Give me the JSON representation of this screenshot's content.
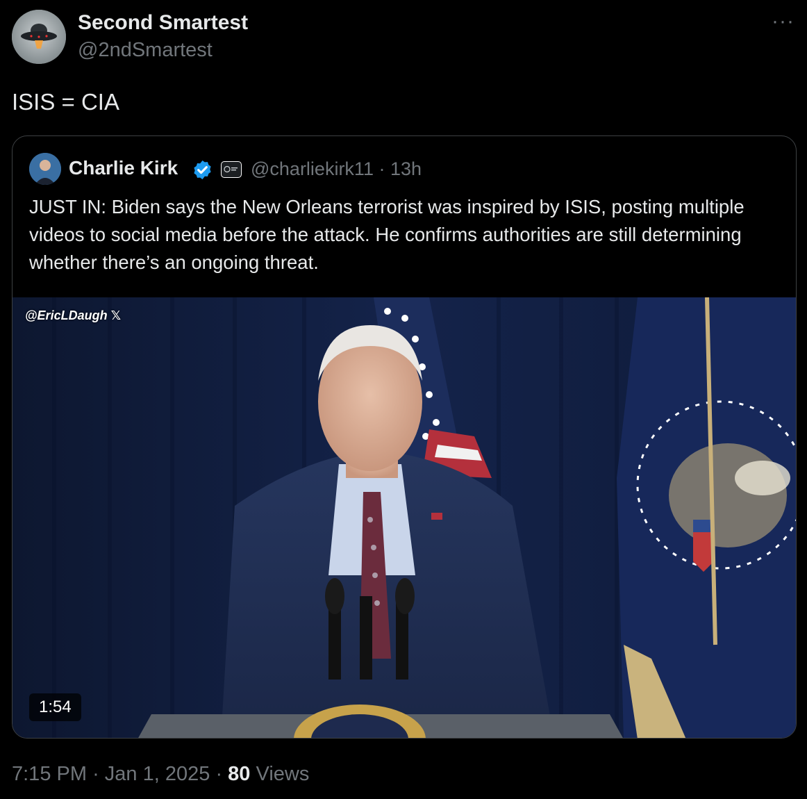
{
  "author": {
    "display_name": "Second Smartest",
    "handle": "@2ndSmartest",
    "avatar_icon": "ufo-icon"
  },
  "more_label": "···",
  "tweet_text": "ISIS = CIA",
  "quoted": {
    "display_name": "Charlie Kirk",
    "handle": "@charliekirk11",
    "separator": "·",
    "age": "13h",
    "verified_color": "#1d9bf0",
    "text": "JUST IN: Biden says the New Orleans terrorist was inspired by ISIS, posting multiple videos to social media before the attack. He confirms authorities are still determining whether there’s an ongoing threat.",
    "media": {
      "watermark": "@EricLDaugh",
      "duration": "1:54"
    }
  },
  "footer": {
    "time": "7:15 PM",
    "date": "Jan 1, 2025",
    "views_count": "80",
    "views_label": "Views"
  }
}
